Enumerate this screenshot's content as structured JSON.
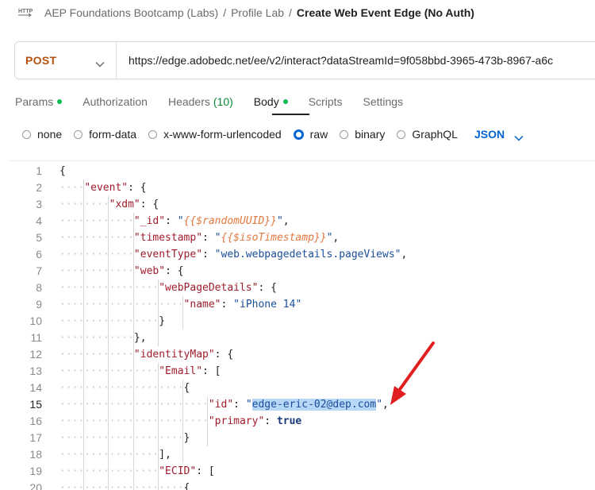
{
  "breadcrumb": {
    "items": [
      "AEP Foundations Bootcamp (Labs)",
      "Profile Lab"
    ],
    "current": "Create Web Event Edge (No Auth)",
    "separator": "/"
  },
  "request": {
    "method": "POST",
    "url": "https://edge.adobedc.net/ee/v2/interact?dataStreamId=9f058bbd-3965-473b-8967-a6c"
  },
  "tabs": [
    {
      "label": "Params",
      "dot": true
    },
    {
      "label": "Authorization"
    },
    {
      "label": "Headers",
      "count": "(10)"
    },
    {
      "label": "Body",
      "dot": true,
      "active": true
    },
    {
      "label": "Scripts"
    },
    {
      "label": "Settings"
    }
  ],
  "body_options": {
    "items": [
      "none",
      "form-data",
      "x-www-form-urlencoded",
      "raw",
      "binary",
      "GraphQL"
    ],
    "selected": "raw",
    "format": "JSON"
  },
  "colors": {
    "method": "#b5500d",
    "accent": "#0265d2",
    "status_dot": "#0cbb52",
    "arrow": "#e02020"
  },
  "editor": {
    "current_line": 15,
    "lines": [
      [
        {
          "t": "p",
          "v": "{"
        }
      ],
      [
        {
          "t": "k",
          "v": "\"event\""
        },
        {
          "t": "p",
          "v": ": {"
        }
      ],
      [
        {
          "t": "k",
          "v": "\"xdm\""
        },
        {
          "t": "p",
          "v": ": {"
        }
      ],
      [
        {
          "t": "k",
          "v": "\"_id\""
        },
        {
          "t": "p",
          "v": ": "
        },
        {
          "t": "s",
          "v": "\""
        },
        {
          "t": "v",
          "v": "{{$randomUUID}}"
        },
        {
          "t": "s",
          "v": "\""
        },
        {
          "t": "p",
          "v": ","
        }
      ],
      [
        {
          "t": "k",
          "v": "\"timestamp\""
        },
        {
          "t": "p",
          "v": ": "
        },
        {
          "t": "s",
          "v": "\""
        },
        {
          "t": "v",
          "v": "{{$isoTimestamp}}"
        },
        {
          "t": "s",
          "v": "\""
        },
        {
          "t": "p",
          "v": ","
        }
      ],
      [
        {
          "t": "k",
          "v": "\"eventType\""
        },
        {
          "t": "p",
          "v": ": "
        },
        {
          "t": "s",
          "v": "\"web.webpagedetails.pageViews\""
        },
        {
          "t": "p",
          "v": ","
        }
      ],
      [
        {
          "t": "k",
          "v": "\"web\""
        },
        {
          "t": "p",
          "v": ": {"
        }
      ],
      [
        {
          "t": "k",
          "v": "\"webPageDetails\""
        },
        {
          "t": "p",
          "v": ": {"
        }
      ],
      [
        {
          "t": "k",
          "v": "\"name\""
        },
        {
          "t": "p",
          "v": ": "
        },
        {
          "t": "s",
          "v": "\"iPhone 14\""
        }
      ],
      [
        {
          "t": "p",
          "v": "}"
        }
      ],
      [
        {
          "t": "p",
          "v": "},"
        }
      ],
      [
        {
          "t": "k",
          "v": "\"identityMap\""
        },
        {
          "t": "p",
          "v": ": {"
        }
      ],
      [
        {
          "t": "k",
          "v": "\"Email\""
        },
        {
          "t": "p",
          "v": ": ["
        }
      ],
      [
        {
          "t": "p",
          "v": "{"
        }
      ],
      [
        {
          "t": "k",
          "v": "\"id\""
        },
        {
          "t": "p",
          "v": ": "
        },
        {
          "t": "s",
          "v": "\""
        },
        {
          "t": "h",
          "v": "edge-eric-02@dep.com"
        },
        {
          "t": "s",
          "v": "\""
        },
        {
          "t": "p",
          "v": ","
        }
      ],
      [
        {
          "t": "k",
          "v": "\"primary\""
        },
        {
          "t": "p",
          "v": ": "
        },
        {
          "t": "b",
          "v": "true"
        }
      ],
      [
        {
          "t": "p",
          "v": "}"
        }
      ],
      [
        {
          "t": "p",
          "v": "],"
        }
      ],
      [
        {
          "t": "k",
          "v": "\"ECID\""
        },
        {
          "t": "p",
          "v": ": ["
        }
      ],
      [
        {
          "t": "p",
          "v": "{"
        }
      ]
    ]
  }
}
